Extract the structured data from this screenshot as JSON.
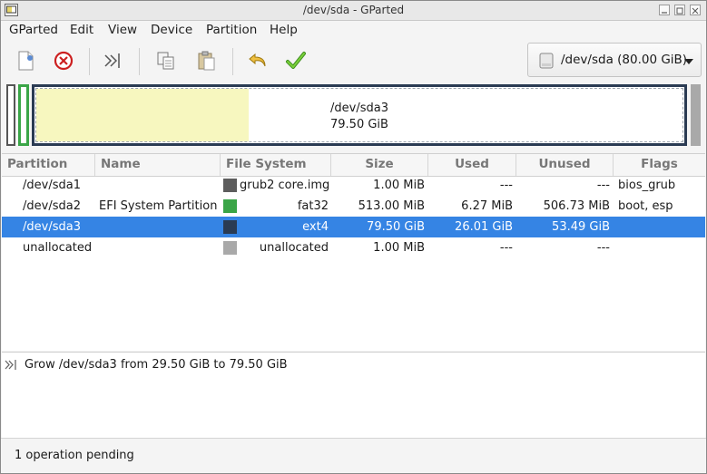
{
  "window": {
    "title": "/dev/sda - GParted"
  },
  "menu": [
    "GParted",
    "Edit",
    "View",
    "Device",
    "Partition",
    "Help"
  ],
  "toolbar": {
    "buttons": [
      "new-icon",
      "delete-icon",
      "resize-move-icon",
      "copy-icon",
      "paste-icon",
      "undo-icon",
      "apply-icon"
    ]
  },
  "device_selector": {
    "label": "/dev/sda (80.00 GiB)"
  },
  "disk_graphic": {
    "selected_name": "/dev/sda3",
    "selected_size": "79.50 GiB"
  },
  "table": {
    "headers": [
      "Partition",
      "Name",
      "File System",
      "Size",
      "Used",
      "Unused",
      "Flags"
    ],
    "rows": [
      {
        "partition": "/dev/sda1",
        "name": "",
        "fs": "grub2 core.img",
        "fs_color": "#5d5d5d",
        "size": "1.00 MiB",
        "used": "---",
        "unused": "---",
        "flags": "bios_grub"
      },
      {
        "partition": "/dev/sda2",
        "name": "EFI System Partition",
        "fs": "fat32",
        "fs_color": "#3aa547",
        "size": "513.00 MiB",
        "used": "6.27 MiB",
        "unused": "506.73 MiB",
        "flags": "boot, esp"
      },
      {
        "partition": "/dev/sda3",
        "name": "",
        "fs": "ext4",
        "fs_color": "#2a3b53",
        "size": "79.50 GiB",
        "used": "26.01 GiB",
        "unused": "53.49 GiB",
        "flags": ""
      },
      {
        "partition": "unallocated",
        "name": "",
        "fs": "unallocated",
        "fs_color": "#a9a9a9",
        "size": "1.00 MiB",
        "used": "---",
        "unused": "---",
        "flags": ""
      }
    ],
    "selected_index": 2
  },
  "pending": {
    "operations": [
      "Grow /dev/sda3 from 29.50 GiB to 79.50 GiB"
    ]
  },
  "status": {
    "text": "1 operation pending"
  },
  "colors": {
    "selection": "#3584e4",
    "used_space": "#f7f7bf",
    "ext4": "#2a3b53",
    "fat32": "#3aa547",
    "unallocated": "#a9a9a9"
  }
}
